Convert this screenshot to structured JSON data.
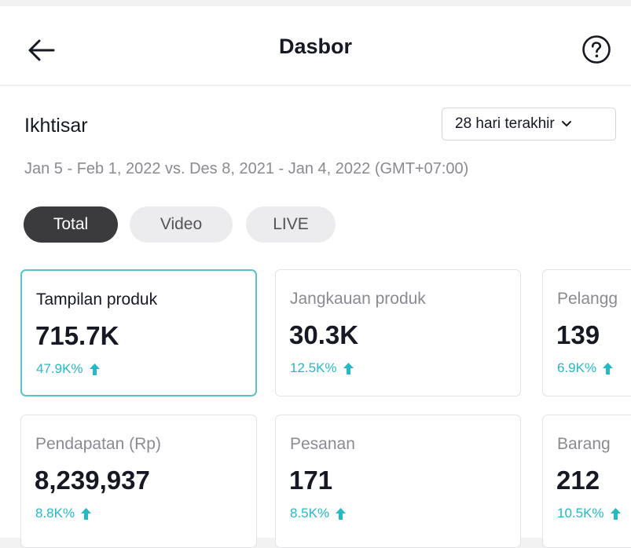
{
  "header": {
    "title": "Dasbor",
    "back_icon": "arrow-left-icon",
    "help_icon": "question-circle-icon"
  },
  "overview": {
    "label": "Ikhtisar",
    "range_select": "28 hari terakhir",
    "date_range": "Jan 5 - Feb 1, 2022 vs. Des 8, 2021 - Jan 4, 2022 (GMT+07:00)"
  },
  "tabs": [
    {
      "label": "Total",
      "selected": true
    },
    {
      "label": "Video",
      "selected": false
    },
    {
      "label": "LIVE",
      "selected": false
    }
  ],
  "metrics": [
    {
      "label": "Tampilan produk",
      "value": "715.7K",
      "change": "47.9K%",
      "selected": true
    },
    {
      "label": "Jangkauan produk",
      "value": "30.3K",
      "change": "12.5K%",
      "selected": false
    },
    {
      "label": "Pelangg",
      "value": "139",
      "change": "6.9K%",
      "selected": false
    },
    {
      "label": "Pendapatan (Rp)",
      "value": "8,239,937",
      "change": "8.8K%",
      "selected": false
    },
    {
      "label": "Pesanan",
      "value": "171",
      "change": "8.5K%",
      "selected": false
    },
    {
      "label": "Barang",
      "value": "212",
      "change": "10.5K%",
      "selected": false
    }
  ],
  "colors": {
    "accent": "#25b9c6",
    "selected_border": "#58c3cd",
    "tab_active": "#3b3b3e",
    "tab_inactive": "#ececee"
  }
}
